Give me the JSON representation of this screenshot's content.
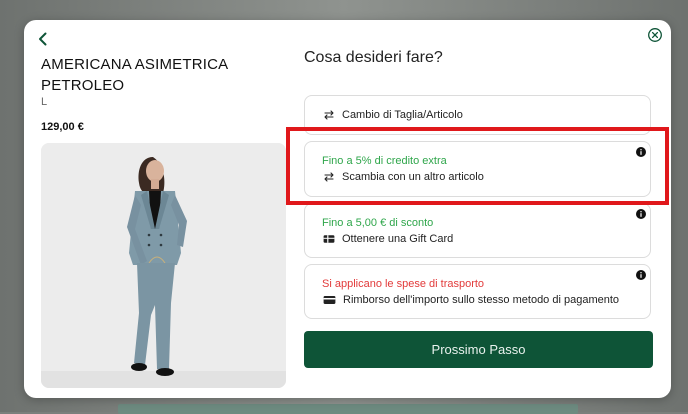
{
  "product": {
    "title": "AMERICANA ASIMETRICA PETROLEO",
    "size": "L",
    "price": "129,00 €"
  },
  "question": "Cosa desideri fare?",
  "options": [
    {
      "hint": "",
      "label": "Cambio di Taglia/Articolo",
      "icon": "swap-icon"
    },
    {
      "hint": "Fino a 5% di credito extra",
      "hint_color": "#2fa64b",
      "label": "Scambia con un altro articolo",
      "icon": "swap-icon",
      "info": "info-icon"
    },
    {
      "hint": "Fino a 5,00 € di sconto",
      "hint_color": "#2fa64b",
      "label": "Ottenere una Gift Card",
      "icon": "gift-card-icon",
      "info": "info-icon"
    },
    {
      "hint": "Si applicano le spese di trasporto",
      "hint_color": "#e23a3a",
      "label": "Rimborso dell'importo sullo stesso metodo di pagamento",
      "icon": "credit-card-icon",
      "info": "info-icon"
    }
  ],
  "next_button": "Prossimo Passo",
  "colors": {
    "primary": "#0e5437",
    "highlight": "#e0181b",
    "green_hint": "#2fa64b",
    "red_hint": "#e23a3a"
  }
}
